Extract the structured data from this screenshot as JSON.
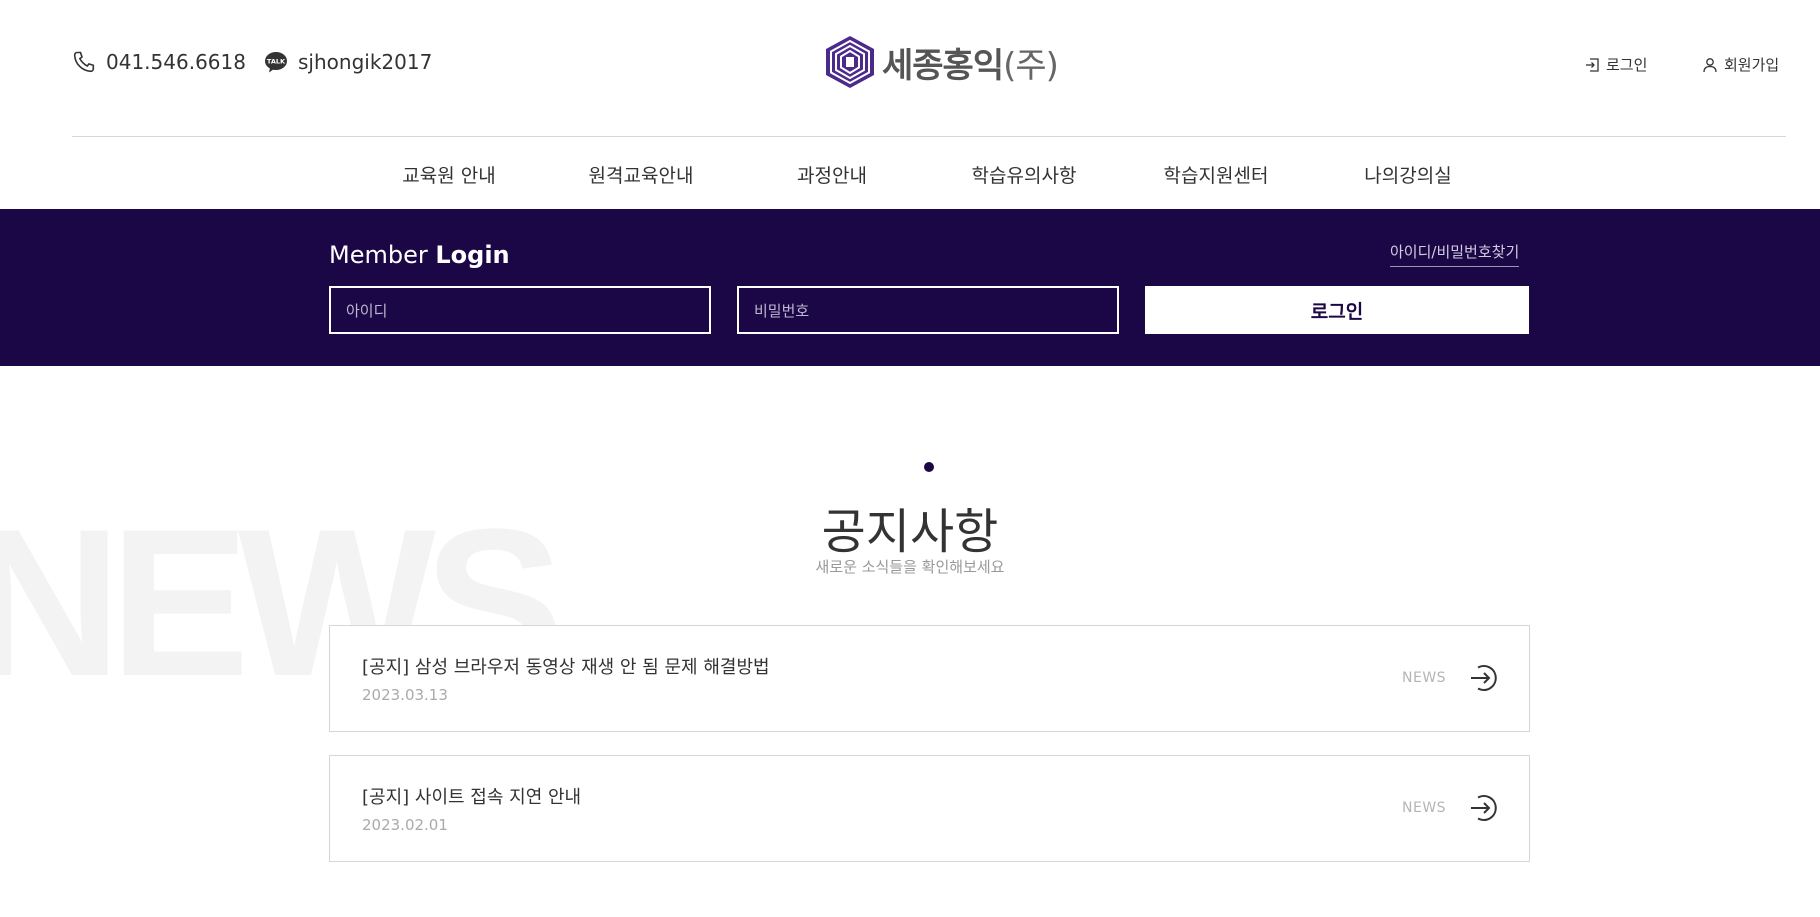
{
  "header": {
    "phone": "041.546.6618",
    "kakao_id": "sjhongik2017",
    "kakao_badge": "TALK",
    "logo_text": "세종홍익",
    "logo_suffix": "(주)",
    "login_label": "로그인",
    "join_label": "회원가입",
    "icons": [
      "phone-icon",
      "kakaotalk-icon",
      "logo-mark-icon",
      "login-icon",
      "user-icon"
    ]
  },
  "nav": {
    "items": [
      {
        "label": "교육원 안내"
      },
      {
        "label": "원격교육안내"
      },
      {
        "label": "과정안내"
      },
      {
        "label": "학습유의사항"
      },
      {
        "label": "학습지원센터"
      },
      {
        "label": "나의강의실"
      }
    ]
  },
  "login": {
    "title_light": "Member ",
    "title_bold": "Login",
    "find_link": "아이디/비밀번호찾기",
    "id_placeholder": "아이디",
    "pw_placeholder": "비밀번호",
    "submit_label": "로그인",
    "band_color": "#1c0746"
  },
  "notice": {
    "background_word": "NEWS",
    "title": "공지사항",
    "subtitle": "새로운 소식들을 확인해보세요",
    "items": [
      {
        "title": "[공지] 삼성 브라우저 동영상 재생 안 됨 문제 해결방법",
        "date": "2023.03.13",
        "tag": "NEWS"
      },
      {
        "title": "[공지] 사이트 접속 지연 안내",
        "date": "2023.02.01",
        "tag": "NEWS"
      }
    ]
  }
}
